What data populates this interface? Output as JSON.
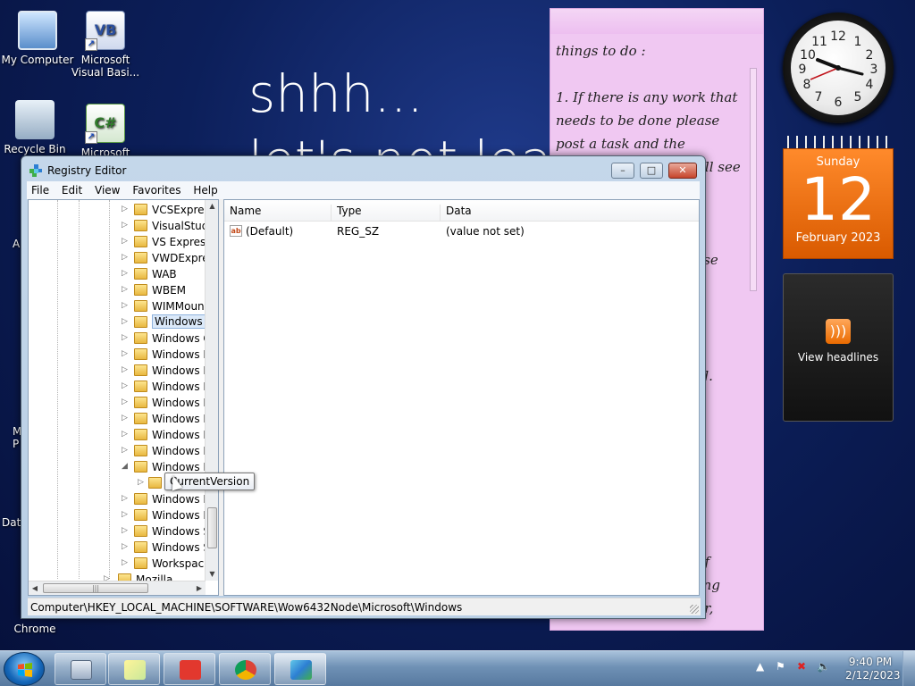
{
  "desktop": {
    "icons": [
      {
        "label": "My Computer"
      },
      {
        "label": "Microsoft Visual Basi..."
      },
      {
        "label": "Recycle Bin"
      },
      {
        "label": "Microsoft"
      },
      {
        "label": "Chrome"
      }
    ],
    "edge_fragments": [
      "A",
      "M",
      "P",
      "Dat"
    ],
    "wallpaper_text": "shhh...\nlet's not leak"
  },
  "sticky_note": {
    "text": "things to do :\n\n1. If there is any work that needs to be done please post a task and the\n                                  ill see\n\n\n                              ist,\n                              . Use\n                                y\n\n                               ,\n\n                              ged.\n                               ’.\n                               r\n\n\n\n                               k\n                               23\n                              h of\n                              uring\n                              War,"
  },
  "gadgets": {
    "clock": {
      "time": "9:40"
    },
    "calendar": {
      "day_of_week": "Sunday",
      "day": "12",
      "month_year": "February 2023"
    },
    "rss": {
      "label": "View headlines"
    }
  },
  "window": {
    "title": "Registry Editor",
    "buttons": {
      "minimize": "–",
      "maximize": "□",
      "close": "✕"
    },
    "menu": [
      "File",
      "Edit",
      "View",
      "Favorites",
      "Help"
    ],
    "tree_items": [
      {
        "label": "VCSExpress",
        "expand": "▷"
      },
      {
        "label": "VisualStudi",
        "expand": "▷"
      },
      {
        "label": "VS Express",
        "expand": "▷"
      },
      {
        "label": "VWDExpres",
        "expand": "▷"
      },
      {
        "label": "WAB",
        "expand": "▷"
      },
      {
        "label": "WBEM",
        "expand": "▷"
      },
      {
        "label": "WIMMoun",
        "expand": "▷"
      },
      {
        "label": "Windows",
        "expand": "▷",
        "selected": true
      },
      {
        "label": "Windows C",
        "expand": "▷"
      },
      {
        "label": "Windows D",
        "expand": "▷"
      },
      {
        "label": "Windows D",
        "expand": "▷"
      },
      {
        "label": "Windows N",
        "expand": "▷"
      },
      {
        "label": "Windows N",
        "expand": "▷"
      },
      {
        "label": "Windows N",
        "expand": "▷"
      },
      {
        "label": "Windows N",
        "expand": "▷"
      },
      {
        "label": "Windows N",
        "expand": "▷"
      },
      {
        "label": "Windows N",
        "expand": "◢"
      },
      {
        "label": "CurrentVersion",
        "expand": "▷",
        "child": true
      },
      {
        "label": "Windows P",
        "expand": "▷"
      },
      {
        "label": "Windows P",
        "expand": "▷"
      },
      {
        "label": "Windows S",
        "expand": "▷"
      },
      {
        "label": "Windows S",
        "expand": "▷"
      },
      {
        "label": "Workspace",
        "expand": "▷"
      },
      {
        "label": "Mozilla",
        "expand": "▷",
        "mozilla": true
      }
    ],
    "list": {
      "columns": [
        "Name",
        "Type",
        "Data"
      ],
      "rows": [
        {
          "name": "(Default)",
          "type": "REG_SZ",
          "data": "(value not set)"
        }
      ]
    },
    "status_path": "Computer\\HKEY_LOCAL_MACHINE\\SOFTWARE\\Wow6432Node\\Microsoft\\Windows",
    "tooltip": "CurrentVersion"
  },
  "taskbar": {
    "time": "9:40 PM",
    "date": "2/12/2023"
  },
  "colors": {
    "desktop": "#0c1f5a",
    "sticky": "#f0c8f2",
    "calendar": "#f07a1a",
    "window_frame": "#c4d7ea"
  }
}
